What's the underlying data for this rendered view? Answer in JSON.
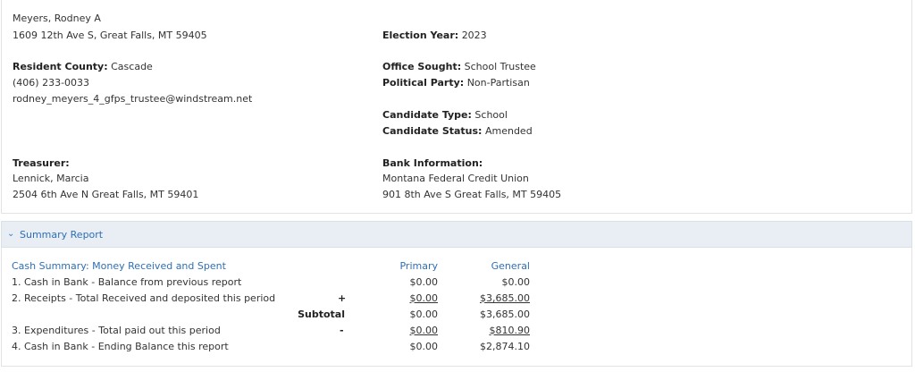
{
  "candidate": {
    "name": "Meyers, Rodney A",
    "address": "1609 12th Ave S, Great Falls, MT 59405",
    "county_label": "Resident County:",
    "county_value": "Cascade",
    "phone": "(406) 233-0033",
    "email": "rodney_meyers_4_gfps_trustee@windstream.net"
  },
  "election": {
    "year_label": "Election Year:",
    "year_value": "2023",
    "office_label": "Office Sought:",
    "office_value": "School Trustee",
    "party_label": "Political Party:",
    "party_value": "Non-Partisan",
    "type_label": "Candidate Type:",
    "type_value": "School",
    "status_label": "Candidate Status:",
    "status_value": "Amended"
  },
  "treasurer": {
    "label": "Treasurer:",
    "name": "Lennick, Marcia",
    "address": "2504 6th Ave N Great Falls, MT 59401"
  },
  "bank": {
    "label": "Bank Information:",
    "name": "Montana Federal Credit Union",
    "address": "901 8th Ave S Great Falls, MT 59405"
  },
  "summary": {
    "chevron": "⌄",
    "header": "Summary Report",
    "section_title": "Cash Summary: Money Received and Spent",
    "col_primary": "Primary",
    "col_general": "General",
    "rows": [
      {
        "label": "1. Cash in Bank - Balance from previous report",
        "op": "",
        "primary": "$0.00",
        "general": "$0.00"
      },
      {
        "label": "2. Receipts - Total Received and deposited this period",
        "op": "+",
        "primary": "$0.00",
        "general": "$3,685.00"
      },
      {
        "label": "",
        "op": "Subtotal",
        "primary": "$0.00",
        "general": "$3,685.00"
      },
      {
        "label": "3. Expenditures - Total paid out this period",
        "op": "-",
        "primary": "$0.00",
        "general": "$810.90"
      },
      {
        "label": "4. Cash in Bank - Ending Balance this report",
        "op": "",
        "primary": "$0.00",
        "general": "$2,874.10"
      }
    ]
  }
}
